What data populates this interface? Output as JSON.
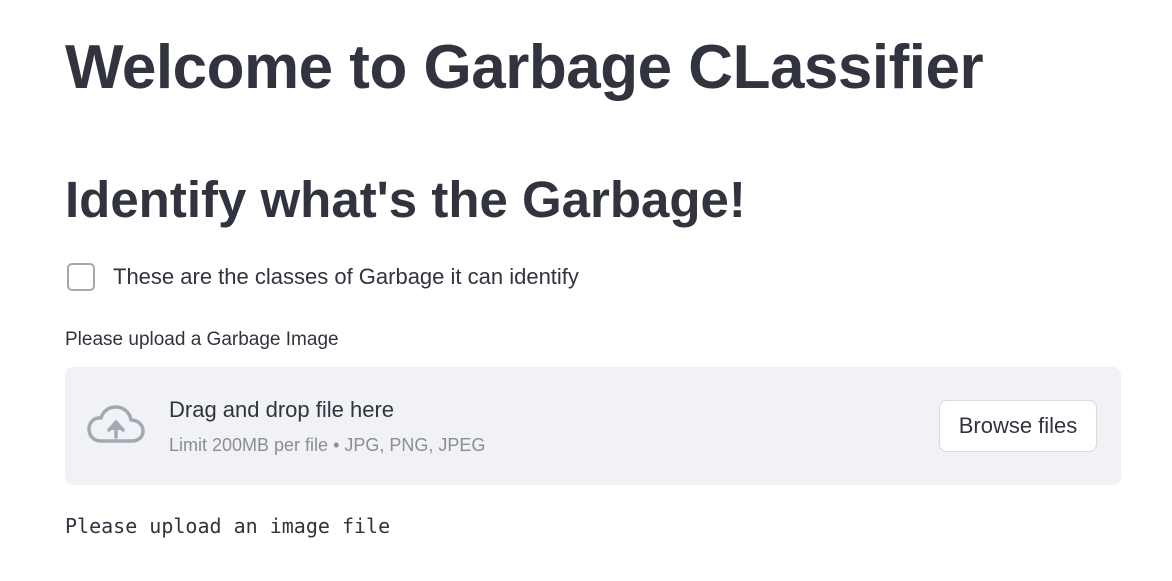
{
  "page": {
    "title": "Welcome to Garbage CLassifier",
    "subtitle": "Identify what's the Garbage!"
  },
  "checkbox": {
    "label": "These are the classes of Garbage it can identify",
    "checked": false
  },
  "uploader": {
    "label": "Please upload a Garbage Image",
    "dropzone_title": "Drag and drop file here",
    "limit_text": "Limit 200MB per file • JPG, PNG, JPEG",
    "browse_label": "Browse files",
    "icon": "cloud-upload-icon"
  },
  "message": {
    "text": "Please upload an image file"
  },
  "colors": {
    "text": "#31333f",
    "dropzone_bg": "#f0f2f6",
    "muted": "#8b8d95",
    "icon": "#a3a8b4"
  }
}
